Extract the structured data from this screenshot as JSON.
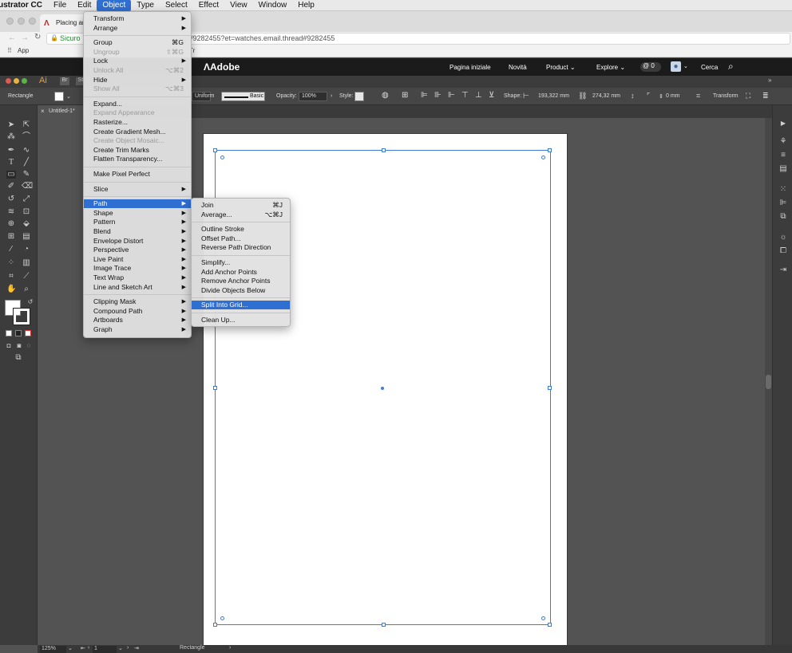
{
  "menubar": {
    "app_name": "ustrator CC",
    "items": [
      "File",
      "Edit",
      "Object",
      "Type",
      "Select",
      "Effect",
      "View",
      "Window",
      "Help"
    ],
    "active": "Object"
  },
  "browser": {
    "tab_title": "Placing ar",
    "secure_label": "Sicuro",
    "url_fragment": "ge/9282455?et=watches.email.thread#9282455",
    "bookmarks_apps": "App",
    "bookmark_fragment": "Tr"
  },
  "adobe_header": {
    "logo": "Adobe",
    "nav": [
      "Pagina iniziale",
      "Novità",
      "Product",
      "Explore"
    ],
    "mentions_count": "0",
    "search_label": "Cerca"
  },
  "illustrator": {
    "app_short": "Ai",
    "bridge": "Br",
    "stock": "St",
    "control_bar": {
      "selection_label": "Rectangle",
      "stroke_profile": "Uniform",
      "brush": "Basic",
      "opacity_label": "Opacity:",
      "opacity_value": "100%",
      "style_label": "Style:",
      "shape_label": "Shape:",
      "width_value": "193,322 mm",
      "height_value": "274,32 mm",
      "corner_value": "0 mm",
      "transform_label": "Transform"
    },
    "doc_tab": "Untitled-1*",
    "status": {
      "zoom": "125%",
      "artboard_num": "1",
      "tool_name": "Rectangle"
    }
  },
  "object_menu": {
    "items": [
      {
        "label": "Transform",
        "submenu": true
      },
      {
        "label": "Arrange",
        "submenu": true
      },
      {
        "sep": true
      },
      {
        "label": "Group",
        "shortcut": "⌘G"
      },
      {
        "label": "Ungroup",
        "shortcut": "⇧⌘G",
        "disabled": true
      },
      {
        "label": "Lock",
        "submenu": true
      },
      {
        "label": "Unlock All",
        "shortcut": "⌥⌘2",
        "disabled": true
      },
      {
        "label": "Hide",
        "submenu": true
      },
      {
        "label": "Show All",
        "shortcut": "⌥⌘3",
        "disabled": true
      },
      {
        "sep": true
      },
      {
        "label": "Expand..."
      },
      {
        "label": "Expand Appearance",
        "disabled": true
      },
      {
        "label": "Rasterize..."
      },
      {
        "label": "Create Gradient Mesh..."
      },
      {
        "label": "Create Object Mosaic...",
        "disabled": true
      },
      {
        "label": "Create Trim Marks"
      },
      {
        "label": "Flatten Transparency..."
      },
      {
        "sep": true
      },
      {
        "label": "Make Pixel Perfect"
      },
      {
        "sep": true
      },
      {
        "label": "Slice",
        "submenu": true
      },
      {
        "sep": true
      },
      {
        "label": "Path",
        "submenu": true,
        "highlight": true
      },
      {
        "label": "Shape",
        "submenu": true
      },
      {
        "label": "Pattern",
        "submenu": true
      },
      {
        "label": "Blend",
        "submenu": true
      },
      {
        "label": "Envelope Distort",
        "submenu": true
      },
      {
        "label": "Perspective",
        "submenu": true
      },
      {
        "label": "Live Paint",
        "submenu": true
      },
      {
        "label": "Image Trace",
        "submenu": true
      },
      {
        "label": "Text Wrap",
        "submenu": true
      },
      {
        "label": "Line and Sketch Art",
        "submenu": true
      },
      {
        "sep": true
      },
      {
        "label": "Clipping Mask",
        "submenu": true
      },
      {
        "label": "Compound Path",
        "submenu": true
      },
      {
        "label": "Artboards",
        "submenu": true
      },
      {
        "label": "Graph",
        "submenu": true
      }
    ]
  },
  "path_menu": {
    "items": [
      {
        "label": "Join",
        "shortcut": "⌘J"
      },
      {
        "label": "Average...",
        "shortcut": "⌥⌘J"
      },
      {
        "sep": true
      },
      {
        "label": "Outline Stroke"
      },
      {
        "label": "Offset Path..."
      },
      {
        "label": "Reverse Path Direction"
      },
      {
        "sep": true
      },
      {
        "label": "Simplify..."
      },
      {
        "label": "Add Anchor Points"
      },
      {
        "label": "Remove Anchor Points"
      },
      {
        "label": "Divide Objects Below"
      },
      {
        "sep": true
      },
      {
        "label": "Split Into Grid...",
        "highlight": true
      },
      {
        "sep": true
      },
      {
        "label": "Clean Up..."
      }
    ]
  },
  "icons": [
    "apple-close",
    "back-arrow",
    "forward-arrow",
    "reload",
    "lock",
    "apps-grid",
    "at-sign",
    "user",
    "search",
    "selection",
    "direct-selection",
    "pen",
    "type",
    "rectangle",
    "brush",
    "eraser",
    "rotate",
    "scale",
    "hand",
    "zoom"
  ]
}
